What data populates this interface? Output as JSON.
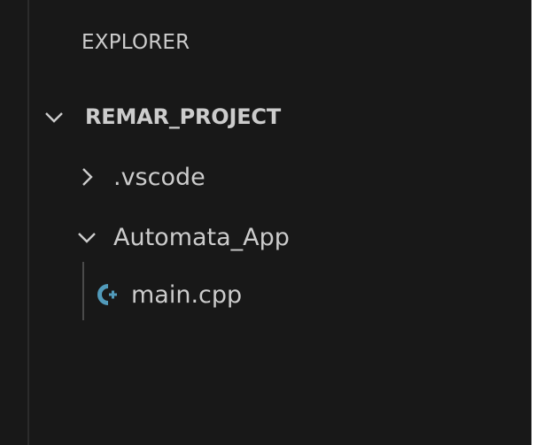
{
  "sidebar": {
    "title": "EXPLORER",
    "folder": {
      "name": "REMAR_PROJECT",
      "expanded": true,
      "icon": "chevron-down-icon",
      "children": [
        {
          "name": ".vscode",
          "type": "folder",
          "expanded": false,
          "icon": "chevron-right-icon"
        },
        {
          "name": "Automata_App",
          "type": "folder",
          "expanded": true,
          "icon": "chevron-down-icon",
          "children": [
            {
              "name": "main.cpp",
              "type": "file",
              "icon": "cpp-file-icon"
            }
          ]
        }
      ]
    }
  },
  "colors": {
    "background": "#181818",
    "text": "#cccccc",
    "cpp_icon": "#519aba",
    "indent_guide": "#4a4a4a"
  }
}
